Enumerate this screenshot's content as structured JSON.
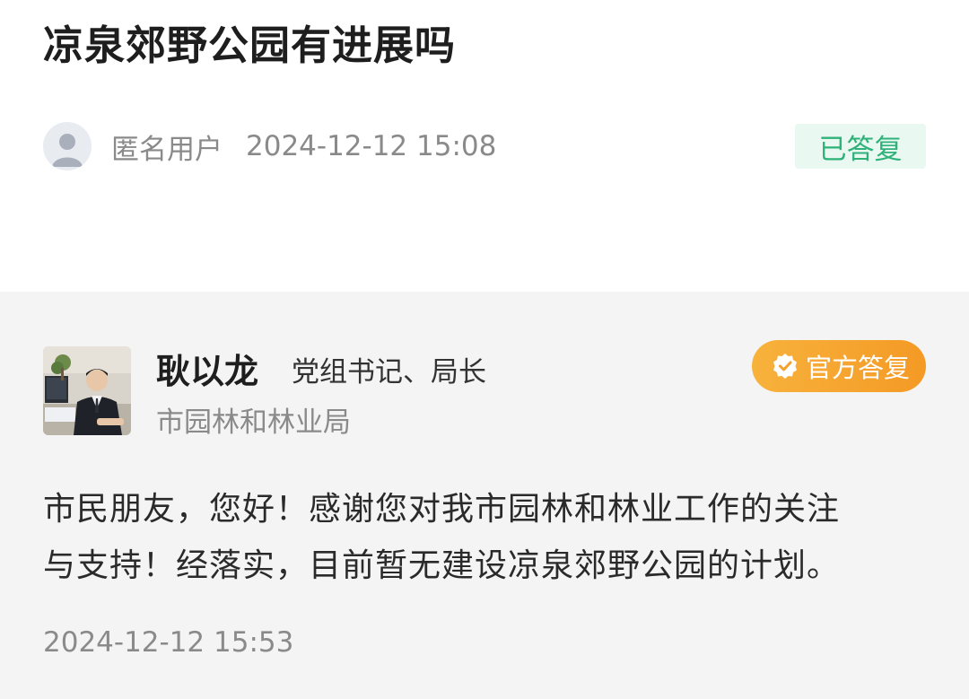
{
  "question": {
    "title": "凉泉郊野公园有进展吗",
    "asker_name": "匿名用户",
    "asker_time": "2024-12-12 15:08",
    "status": "已答复"
  },
  "answer": {
    "official_name": "耿以龙",
    "official_title": "党组书记、局长",
    "department": "市园林和林业局",
    "badge_label": "官方答复",
    "reply_lines": [
      "市民朋友，您好！感谢您对我市园林和林业工作的关注",
      "与支持！经落实，目前暂无建设凉泉郊野公园的计划。"
    ],
    "reply_time": "2024-12-12 15:53"
  },
  "icons": {
    "asker_avatar": "anonymous-user-icon",
    "badge": "verified-check-icon"
  },
  "colors": {
    "status_text": "#2fb27a",
    "status_bg": "#e9f8f1",
    "badge_start": "#f7b23c",
    "badge_end": "#f49a25",
    "answer_bg": "#f4f4f4"
  }
}
